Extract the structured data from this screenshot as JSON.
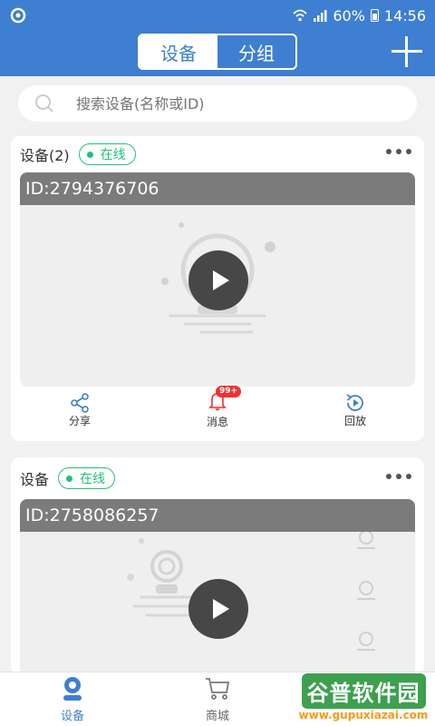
{
  "status_bar": {
    "battery": "60%",
    "time": "14:56"
  },
  "header": {
    "tabs": [
      {
        "label": "设备",
        "active": true
      },
      {
        "label": "分组",
        "active": false
      }
    ],
    "add_icon": "plus-icon"
  },
  "search": {
    "placeholder": "搜索设备(名称或ID)"
  },
  "devices": [
    {
      "title": "设备(2)",
      "status": "在线",
      "id_label": "ID:2794376706",
      "actions": [
        {
          "label": "分享",
          "icon": "share-icon"
        },
        {
          "label": "消息",
          "icon": "bell-icon",
          "badge": "99+"
        },
        {
          "label": "回放",
          "icon": "playback-icon"
        }
      ]
    },
    {
      "title": "设备",
      "status": "在线",
      "id_label": "ID:2758086257"
    }
  ],
  "bottom_nav": [
    {
      "label": "设备",
      "icon": "device-icon",
      "active": true
    },
    {
      "label": "商城",
      "icon": "cart-icon",
      "active": false
    },
    {
      "label": "",
      "icon": "profile-icon",
      "active": false
    }
  ],
  "watermark": {
    "name": "谷普软件园",
    "url": "www.gupuxiazai.com"
  },
  "colors": {
    "primary": "#3f7fd1",
    "online": "#23c07a",
    "badge": "#f03131"
  }
}
